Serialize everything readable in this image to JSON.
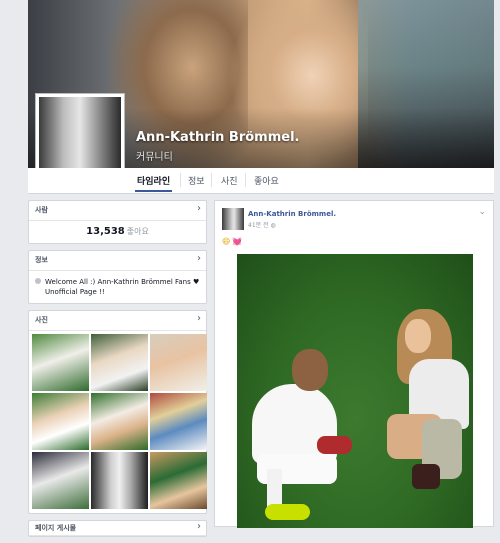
{
  "page": {
    "name": "Ann-Kathrin Brömmel.",
    "category": "커뮤니티"
  },
  "tabs": [
    {
      "label": "타임라인",
      "active": true
    },
    {
      "label": "정보",
      "active": false
    },
    {
      "label": "사진",
      "active": false
    },
    {
      "label": "좋아요",
      "active": false
    }
  ],
  "likes_box": {
    "title": "사람",
    "count": "13,538",
    "count_label": "좋아요"
  },
  "about_box": {
    "title": "정보",
    "text": "Welcome All :) Ann-Kathrin Brömmel Fans ♥ Unofficial Page !!"
  },
  "photos_box": {
    "title": "사진"
  },
  "next_box": {
    "title": "페이지 게시물"
  },
  "post": {
    "author": "Ann-Kathrin Brömmel.",
    "time": "41분 전",
    "emoji_1": "😄",
    "emoji_2": "💓"
  },
  "icons": {
    "arrow": "›",
    "chevron": "⌄",
    "globe": "◍"
  },
  "colors": {
    "link": "#3b5998",
    "tab_underline": "#3b5998",
    "page_bg": "#e9eaed"
  }
}
